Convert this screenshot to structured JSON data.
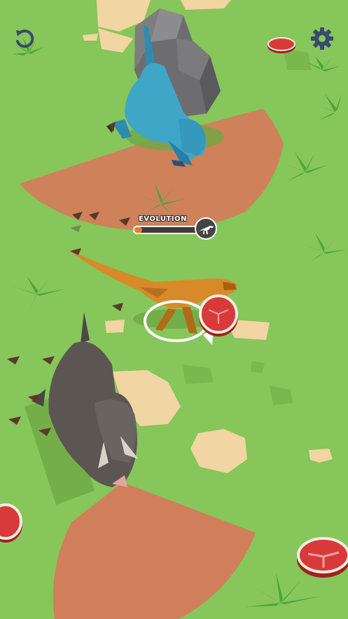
{
  "hud": {
    "restart_icon": "restart-icon",
    "settings_icon": "gear-icon",
    "icon_color": "#3a4a6a"
  },
  "evolution": {
    "label": "EVOLUTION",
    "progress": 0.12,
    "fill_color": "#f07a2a",
    "badge_icon": "raptor-silhouette-icon"
  },
  "colors": {
    "ground": "#86c65a",
    "sand": "#f1d5a2",
    "plant": "#4fa43b",
    "vision_cone": "#d9775a",
    "rex": "#3fa6c8",
    "raptor": "#d88a28",
    "triceratops": "#5c5653",
    "meat": "#d83a3a"
  }
}
